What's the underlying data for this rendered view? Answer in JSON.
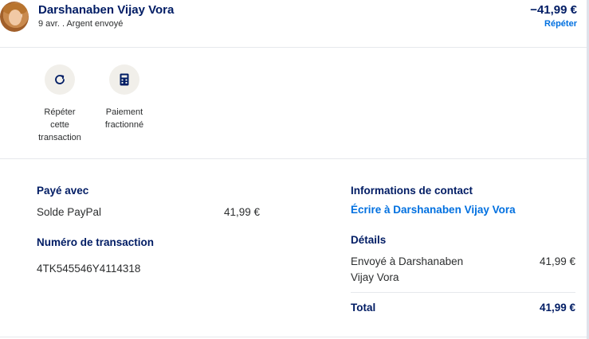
{
  "header": {
    "name": "Darshanaben Vijay Vora",
    "subtitle": "9 avr. . Argent envoyé",
    "amount": "−41,99 €",
    "repeat_link": "Répéter"
  },
  "actions": [
    {
      "icon": "refresh-icon",
      "label_lines": [
        "Répéter",
        "cette",
        "transaction"
      ]
    },
    {
      "icon": "calculator-icon",
      "label_lines": [
        "Paiement",
        "fractionné"
      ]
    }
  ],
  "payment": {
    "title": "Payé avec",
    "method": "Solde PayPal",
    "amount": "41,99 €"
  },
  "transaction": {
    "title": "Numéro de transaction",
    "id": "4TK545546Y4114318"
  },
  "contact": {
    "title": "Informations de contact",
    "link": "Écrire à Darshanaben Vijay Vora"
  },
  "details": {
    "title": "Détails",
    "line1": "Envoyé à Darshanaben",
    "line2": "Vijay Vora",
    "amount": "41,99 €",
    "total_label": "Total",
    "total_amount": "41,99 €"
  },
  "colors": {
    "navy": "#001c64",
    "link_blue": "#0070e0",
    "icon_bg": "#f1efea"
  }
}
